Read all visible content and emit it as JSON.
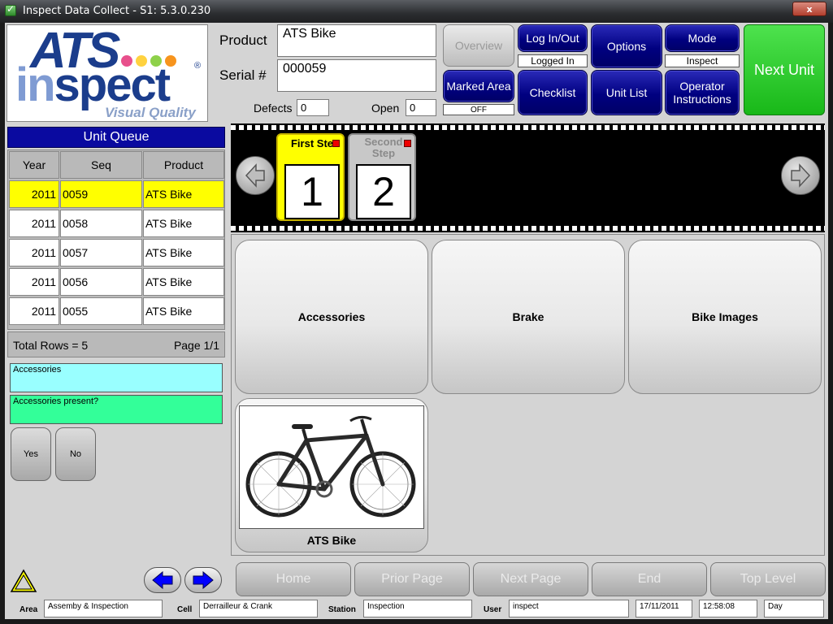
{
  "window": {
    "title": "Inspect Data Collect - S1: 5.3.0.230",
    "close_label": "x"
  },
  "logo": {
    "ats": "ATS",
    "in": "in",
    "spect": "spect",
    "tagline": "Visual Quality",
    "reg": "®",
    "dot_colors": [
      "#e8508c",
      "#ffd23f",
      "#8ed14a",
      "#f7941d"
    ]
  },
  "header": {
    "product_label": "Product",
    "product_value": "ATS Bike",
    "serial_label": "Serial #",
    "serial_value": "000059",
    "defects_label": "Defects",
    "defects_value": "0",
    "open_label": "Open",
    "open_value": "0"
  },
  "buttons": {
    "overview": "Overview",
    "login": "Log In/Out",
    "login_status": "Logged In",
    "options": "Options",
    "mode": "Mode",
    "mode_status": "Inspect",
    "next_unit": "Next Unit",
    "marked_area": "Marked Area",
    "marked_area_status": "OFF",
    "checklist": "Checklist",
    "unit_list": "Unit List",
    "operator_line1": "Operator",
    "operator_line2": "Instructions"
  },
  "queue": {
    "title": "Unit Queue",
    "columns": [
      "Year",
      "Seq",
      "Product"
    ],
    "rows": [
      {
        "year": "2011",
        "seq": "0059",
        "product": "ATS Bike"
      },
      {
        "year": "2011",
        "seq": "0058",
        "product": "ATS Bike"
      },
      {
        "year": "2011",
        "seq": "0057",
        "product": "ATS Bike"
      },
      {
        "year": "2011",
        "seq": "0056",
        "product": "ATS Bike"
      },
      {
        "year": "2011",
        "seq": "0055",
        "product": "ATS Bike"
      }
    ],
    "total_rows": "Total Rows = 5",
    "page": "Page 1/1",
    "selected_color": "#ffff00"
  },
  "question": {
    "category": "Accessories",
    "prompt": "Accessories present?",
    "yes_label": "Yes",
    "no_label": "No",
    "category_color": "#99ffff",
    "prompt_color": "#33ff99"
  },
  "steps": [
    {
      "title": "First Ste",
      "number": "1",
      "active": true
    },
    {
      "title_line1": "Second",
      "title_line2": "Step",
      "number": "2",
      "active": false
    }
  ],
  "tiles": [
    {
      "label": "Accessories"
    },
    {
      "label": "Brake"
    },
    {
      "label": "Bike Images"
    },
    {
      "label": "ATS Bike",
      "icon": "bicycle-icon"
    }
  ],
  "nav": {
    "home": "Home",
    "prior": "Prior Page",
    "next": "Next Page",
    "end": "End",
    "top": "Top Level"
  },
  "statusbar": {
    "area_label": "Area",
    "area_value": "Assemby & Inspection",
    "cell_label": "Cell",
    "cell_value": "Derrailleur & Crank",
    "station_label": "Station",
    "station_value": "Inspection",
    "user_label": "User",
    "user_value": "inspect",
    "date": "17/11/2011",
    "time": "12:58:08",
    "shift": "Day"
  }
}
